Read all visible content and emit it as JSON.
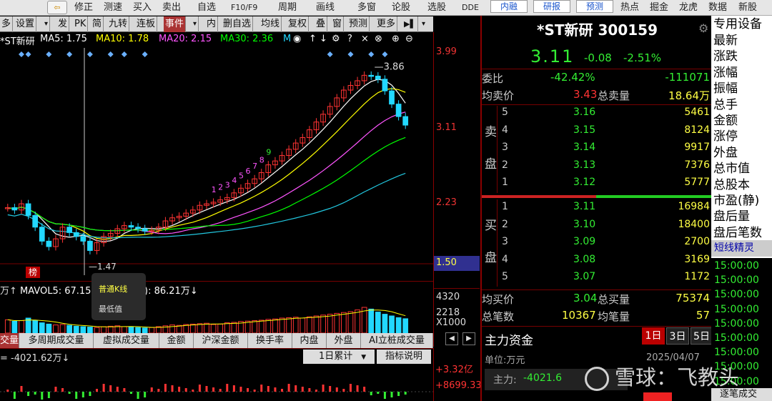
{
  "toolbar": {
    "items": [
      "修正",
      "测速",
      "买入",
      "卖出",
      "自选",
      "F10/F9",
      "周期",
      "画线",
      "多窗",
      "论股",
      "选股",
      "DDE"
    ],
    "buttons": [
      "内融",
      "研报",
      "预测"
    ],
    "right_items": [
      "热点",
      "掘金",
      "龙虎",
      "数据",
      "新股"
    ]
  },
  "chart_toolbar": {
    "items": [
      "多",
      "设置",
      "▾",
      "发",
      "PK",
      "简",
      "九转",
      "连板",
      "事件",
      "▾",
      "内",
      "删自选",
      "均线",
      "复权",
      "叠",
      "窗",
      "预测",
      "更多",
      "▾"
    ]
  },
  "legend": {
    "name": "*ST新研",
    "ma5": "MA5: 1.75",
    "ma10": "MA10: 1.78",
    "ma20": "MA20: 2.15",
    "ma30": "MA30: 2.36",
    "more": "M",
    "colors": {
      "ma5": "#ffffff",
      "ma10": "#ffff00",
      "ma20": "#ff55ff",
      "ma30": "#00ff00"
    }
  },
  "price_axis": {
    "ticks": [
      "3.99",
      "3.11",
      "2.23",
      "1.50"
    ]
  },
  "volume_axis": {
    "ticks": [
      "4320",
      "2218",
      "X1000"
    ]
  },
  "chart_data": {
    "type": "candlestick",
    "price_range": [
      1.47,
      3.99
    ],
    "max_label": "3.86",
    "min_label": "1.47",
    "closes": [
      2.05,
      2.02,
      2.1,
      1.95,
      1.8,
      1.62,
      1.55,
      1.65,
      1.8,
      1.73,
      1.68,
      1.62,
      1.5,
      1.6,
      1.68,
      1.72,
      1.78,
      1.82,
      1.8,
      1.78,
      1.75,
      1.76,
      1.8,
      1.88,
      1.92,
      1.94,
      1.98,
      2.02,
      2.08,
      2.1,
      2.12,
      2.15,
      2.18,
      2.24,
      2.3,
      2.36,
      2.42,
      2.5,
      2.6,
      2.65,
      2.72,
      2.8,
      2.88,
      2.95,
      3.05,
      3.15,
      3.25,
      3.35,
      3.46,
      3.56,
      3.62,
      3.68,
      3.75,
      3.74,
      3.7,
      3.55,
      3.38,
      3.22,
      3.11
    ],
    "volumes": [
      62,
      55,
      58,
      70,
      60,
      48,
      42,
      38,
      40,
      36,
      32,
      30,
      28,
      26,
      30,
      32,
      34,
      30,
      28,
      26,
      24,
      26,
      30,
      34,
      38,
      36,
      40,
      42,
      44,
      46,
      40,
      42,
      48,
      50,
      54,
      56,
      58,
      60,
      64,
      66,
      70,
      72,
      74,
      70,
      76,
      80,
      84,
      88,
      92,
      96,
      100,
      108,
      120,
      112,
      98,
      88,
      80,
      72,
      67
    ],
    "mavol5_label": "MAVOL5: 67.15",
    "vol_label2": "86.21万"
  },
  "nine_turn_labels": [
    "1",
    "2",
    "3",
    "4",
    "5",
    "6",
    "7",
    "8",
    "9"
  ],
  "bang_label": "榜",
  "tooltip": {
    "title": "普通K线",
    "text": "最低值"
  },
  "bottom_tabs": [
    "交量",
    "多周期成交量",
    "虚拟成交量",
    "金额",
    "沪深金额",
    "换手率",
    "内盘",
    "外盘",
    "AI立桩成交量"
  ],
  "sub_chart": {
    "value": "-4021.62万",
    "period": "1日累计",
    "explain": "指标说明",
    "ticks": [
      "+3.32亿",
      "+8699.33"
    ]
  },
  "stock": {
    "title": "*ST新研 300159",
    "price": "3.11",
    "change": "-0.08",
    "pct": "-2.51%",
    "weibi_label": "委比",
    "weibi": "-42.42%",
    "weicha": "-111071",
    "avg_sell_label": "均卖价",
    "avg_sell": "3.43",
    "total_sell_label": "总卖量",
    "total_sell": "18.64万",
    "sell_side": "卖盘",
    "buy_side": "买盘",
    "asks": [
      {
        "level": "5",
        "price": "3.16",
        "vol": "5461"
      },
      {
        "level": "4",
        "price": "3.15",
        "vol": "8124"
      },
      {
        "level": "3",
        "price": "3.14",
        "vol": "9917"
      },
      {
        "level": "2",
        "price": "3.13",
        "vol": "7376"
      },
      {
        "level": "1",
        "price": "3.12",
        "vol": "5777"
      }
    ],
    "bids": [
      {
        "level": "1",
        "price": "3.11",
        "vol": "16984"
      },
      {
        "level": "2",
        "price": "3.10",
        "vol": "18400"
      },
      {
        "level": "3",
        "price": "3.09",
        "vol": "2700"
      },
      {
        "level": "4",
        "price": "3.08",
        "vol": "3169"
      },
      {
        "level": "5",
        "price": "3.07",
        "vol": "1172"
      }
    ],
    "avg_buy_label": "均买价",
    "avg_buy": "3.04",
    "total_buy_label": "总买量",
    "total_buy": "75374",
    "trades_label": "总笔数",
    "trades": "10367",
    "avg_vol_label": "均笔量",
    "avg_vol": "57",
    "capital_title": "主力资金",
    "period_tabs": [
      "1日",
      "3日",
      "5日"
    ],
    "unit": "单位:万元",
    "date": "2025/04/07",
    "main_label": "主力:",
    "main_value": "-4021.6"
  },
  "side_menu": {
    "title": "专用设备",
    "items": [
      "最新",
      "涨跌",
      "涨幅",
      "振幅",
      "总手",
      "金额",
      "涨停",
      "外盘",
      "总市值",
      "总股本",
      "市盈(静)",
      "盘后量",
      "盘后笔数"
    ],
    "spirit": "短线精灵",
    "times": [
      "15:00:00",
      "15:00:00",
      "15:00:00",
      "15:00:00",
      "15:00:00",
      "15:00:00",
      "15:00:00",
      "15:00:00",
      "15:00:00"
    ],
    "last": "逐笔成交"
  },
  "watermark": "雪球：飞教头"
}
